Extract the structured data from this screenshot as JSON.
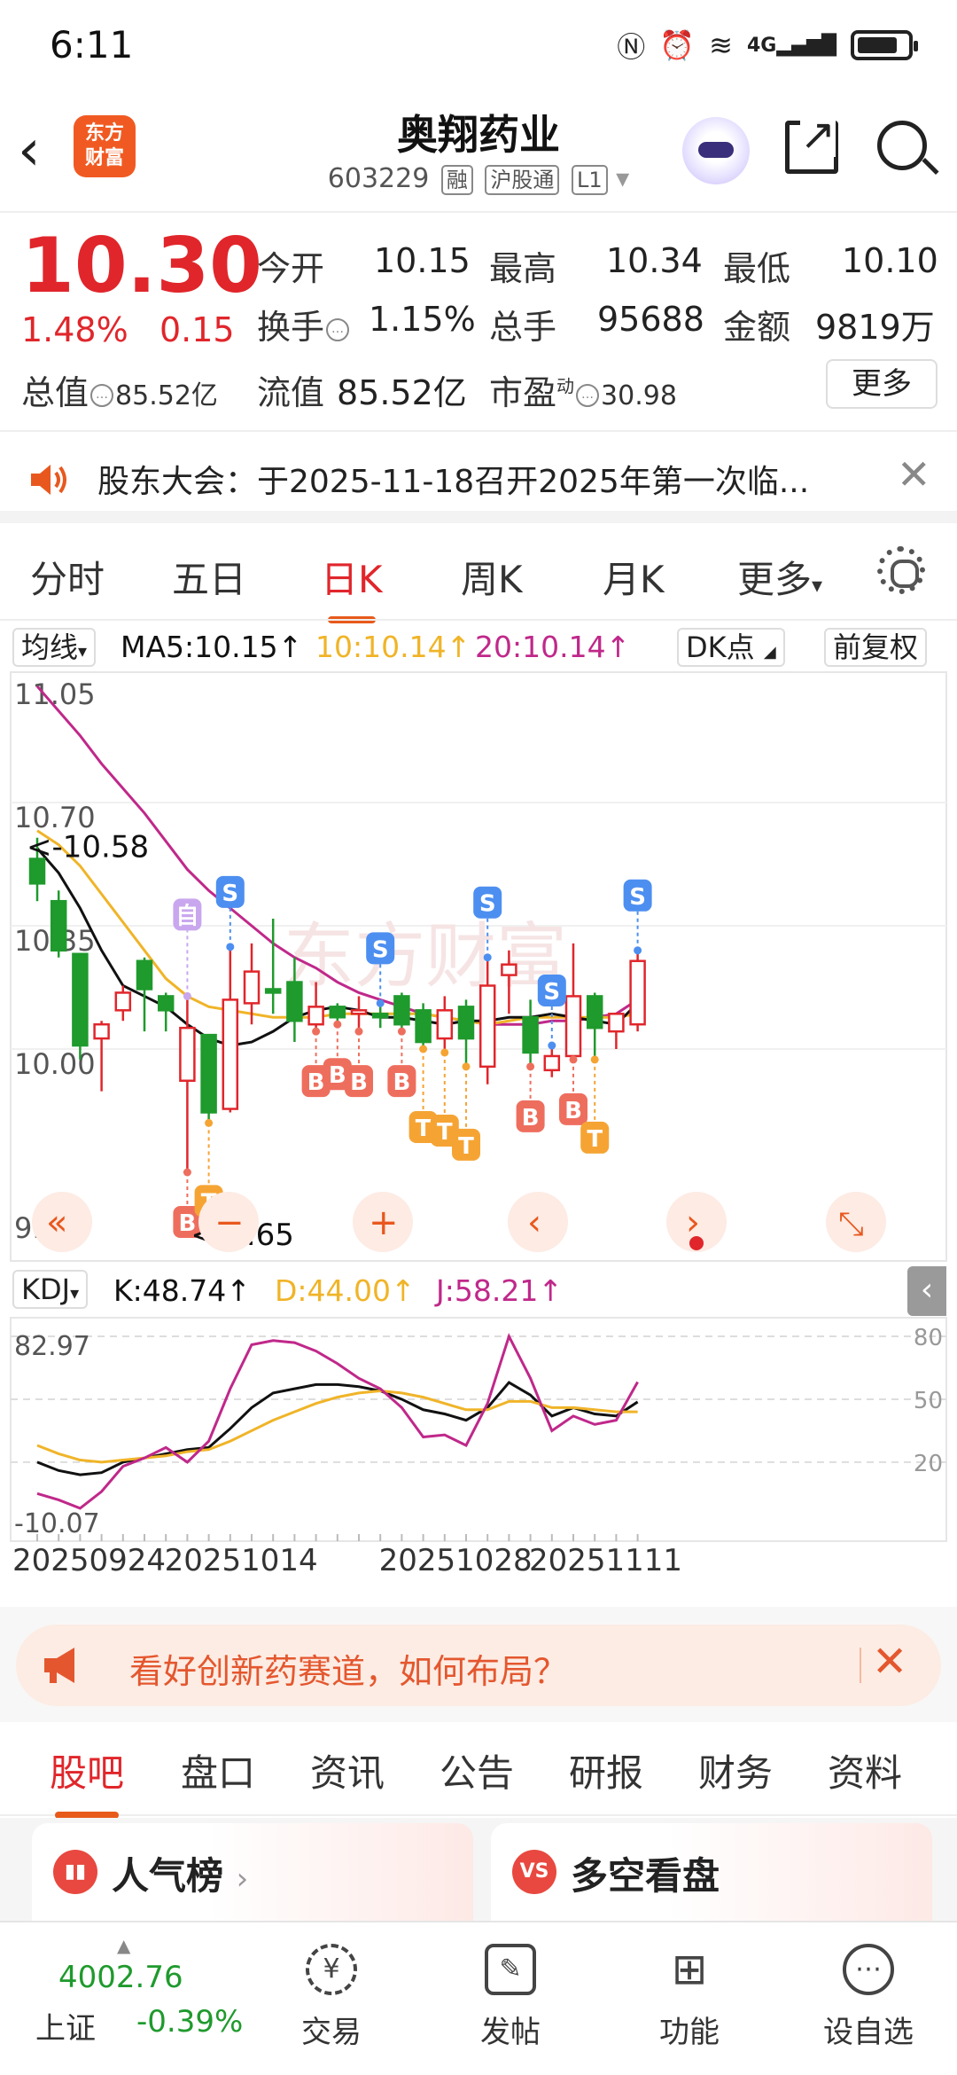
{
  "status_bar": {
    "time": "6:11",
    "icons": [
      "nfc-icon",
      "alarm-icon",
      "wifi-icon",
      "4g-signal-icon",
      "battery-icon"
    ],
    "network": "4G"
  },
  "header": {
    "logo_text_1": "东方",
    "logo_text_2": "财富",
    "stock_name": "奥翔药业",
    "stock_code": "603229",
    "tags": [
      "融",
      "沪股通",
      "L1"
    ]
  },
  "quote": {
    "price": "10.30",
    "change_pct": "1.48%",
    "change_abs": "0.15",
    "open_label": "今开",
    "open": "10.15",
    "high_label": "最高",
    "high": "10.34",
    "low_label": "最低",
    "low": "10.10",
    "turnover_label": "换手",
    "turnover": "1.15%",
    "volume_label": "总手",
    "volume": "95688",
    "amount_label": "金额",
    "amount": "9819万",
    "total_cap_label": "总值",
    "total_cap": "85.52亿",
    "float_cap_label": "流值",
    "float_cap": "85.52亿",
    "pe_label": "市盈",
    "pe_sup": "动",
    "pe": "30.98",
    "more_label": "更多"
  },
  "notice": {
    "text": "股东大会：于2025-11-18召开2025年第一次临..."
  },
  "chart_tabs": [
    "分时",
    "五日",
    "日K",
    "周K",
    "月K",
    "更多"
  ],
  "active_chart_tab": "日K",
  "ma_row": {
    "selector": "均线",
    "ma5": "MA5:10.15↑",
    "ma10": "10:10.14↑",
    "ma20": "20:10.14↑",
    "dk_label": "DK点",
    "adjust_label": "前复权"
  },
  "colors": {
    "up": "#e0262b",
    "down": "#1f9a2d",
    "ma5": "#111111",
    "ma10": "#f0b428",
    "ma20": "#c0288a",
    "accent": "#e85a1a"
  },
  "chart_data": [
    {
      "type": "candlestick",
      "ylim": [
        9.65,
        11.05
      ],
      "y_ticks": [
        "11.05",
        "10.70",
        "10.35",
        "10.00",
        "9.65"
      ],
      "annotations": {
        "max_label": "<-10.58",
        "min_label": "<-9.65"
      },
      "candles": [
        {
          "o": 10.54,
          "c": 10.47,
          "h": 10.6,
          "l": 10.42
        },
        {
          "o": 10.42,
          "c": 10.28,
          "h": 10.45,
          "l": 10.26
        },
        {
          "o": 10.27,
          "c": 10.01,
          "h": 10.27,
          "l": 9.97
        },
        {
          "o": 10.03,
          "c": 10.07,
          "h": 10.08,
          "l": 9.88
        },
        {
          "o": 10.11,
          "c": 10.16,
          "h": 10.18,
          "l": 10.08
        },
        {
          "o": 10.25,
          "c": 10.17,
          "h": 10.26,
          "l": 10.05
        },
        {
          "o": 10.15,
          "c": 10.11,
          "h": 10.16,
          "l": 10.05
        },
        {
          "o": 9.91,
          "c": 10.06,
          "h": 10.15,
          "l": 9.65
        },
        {
          "o": 10.04,
          "c": 9.82,
          "h": 10.04,
          "l": 9.79
        },
        {
          "o": 9.83,
          "c": 10.14,
          "h": 10.29,
          "l": 9.82
        },
        {
          "o": 10.13,
          "c": 10.22,
          "h": 10.3,
          "l": 10.07
        },
        {
          "o": 10.17,
          "c": 10.16,
          "h": 10.37,
          "l": 10.1
        },
        {
          "o": 10.19,
          "c": 10.08,
          "h": 10.26,
          "l": 10.02
        },
        {
          "o": 10.07,
          "c": 10.12,
          "h": 10.19,
          "l": 10.05
        },
        {
          "o": 10.12,
          "c": 10.09,
          "h": 10.13,
          "l": 10.07
        },
        {
          "o": 10.1,
          "c": 10.11,
          "h": 10.15,
          "l": 10.05
        },
        {
          "o": 10.1,
          "c": 10.09,
          "h": 10.13,
          "l": 10.06
        },
        {
          "o": 10.15,
          "c": 10.07,
          "h": 10.16,
          "l": 10.05
        },
        {
          "o": 10.11,
          "c": 10.02,
          "h": 10.13,
          "l": 10.0
        },
        {
          "o": 10.03,
          "c": 10.11,
          "h": 10.15,
          "l": 9.99
        },
        {
          "o": 10.12,
          "c": 10.03,
          "h": 10.14,
          "l": 9.95
        },
        {
          "o": 9.95,
          "c": 10.18,
          "h": 10.26,
          "l": 9.9
        },
        {
          "o": 10.21,
          "c": 10.24,
          "h": 10.28,
          "l": 10.1
        },
        {
          "o": 10.09,
          "c": 9.99,
          "h": 10.14,
          "l": 9.95
        },
        {
          "o": 9.94,
          "c": 9.98,
          "h": 10.01,
          "l": 9.92
        },
        {
          "o": 9.98,
          "c": 10.15,
          "h": 10.3,
          "l": 9.97
        },
        {
          "o": 10.15,
          "c": 10.06,
          "h": 10.16,
          "l": 9.97
        },
        {
          "o": 10.05,
          "c": 10.1,
          "h": 10.09,
          "l": 10.0
        },
        {
          "o": 10.07,
          "c": 10.25,
          "h": 10.28,
          "l": 10.05
        }
      ],
      "ma5": [
        10.57,
        10.5,
        10.4,
        10.28,
        10.18,
        10.15,
        10.12,
        10.07,
        10.03,
        10.01,
        10.02,
        10.05,
        10.09,
        10.11,
        10.12,
        10.11,
        10.09,
        10.09,
        10.08,
        10.07,
        10.08,
        10.08,
        10.09,
        10.09,
        10.1,
        10.09,
        10.08,
        10.07,
        10.13
      ],
      "ma10": [
        10.62,
        10.58,
        10.52,
        10.44,
        10.36,
        10.28,
        10.2,
        10.15,
        10.12,
        10.11,
        10.1,
        10.09,
        10.09,
        10.09,
        10.1,
        10.1,
        10.1,
        10.1,
        10.1,
        10.09,
        10.08,
        10.07,
        10.08,
        10.09,
        10.09,
        10.09,
        10.09,
        10.09,
        10.1
      ],
      "ma20": [
        11.03,
        10.96,
        10.89,
        10.81,
        10.74,
        10.67,
        10.59,
        10.51,
        10.45,
        10.4,
        10.35,
        10.3,
        10.26,
        10.23,
        10.19,
        10.16,
        10.14,
        10.12,
        10.1,
        10.09,
        10.08,
        10.07,
        10.07,
        10.07,
        10.08,
        10.08,
        10.09,
        10.1,
        10.14
      ],
      "signals": [
        {
          "i": 7,
          "label": "自",
          "kind": "zi"
        },
        {
          "i": 7,
          "label": "B",
          "kind": "buy"
        },
        {
          "i": 8,
          "label": "T",
          "kind": "t"
        },
        {
          "i": 9,
          "label": "S",
          "kind": "sell"
        },
        {
          "i": 13,
          "label": "B",
          "kind": "buy"
        },
        {
          "i": 14,
          "label": "B",
          "kind": "buy"
        },
        {
          "i": 15,
          "label": "B",
          "kind": "buy"
        },
        {
          "i": 16,
          "label": "S",
          "kind": "sell"
        },
        {
          "i": 17,
          "label": "B",
          "kind": "buy"
        },
        {
          "i": 18,
          "label": "T",
          "kind": "t"
        },
        {
          "i": 19,
          "label": "T",
          "kind": "t"
        },
        {
          "i": 20,
          "label": "T",
          "kind": "t"
        },
        {
          "i": 21,
          "label": "S",
          "kind": "sell"
        },
        {
          "i": 23,
          "label": "B",
          "kind": "buy"
        },
        {
          "i": 24,
          "label": "S",
          "kind": "sell"
        },
        {
          "i": 25,
          "label": "B",
          "kind": "buy"
        },
        {
          "i": 26,
          "label": "T",
          "kind": "t"
        },
        {
          "i": 28,
          "label": "S",
          "kind": "sell"
        }
      ]
    },
    {
      "type": "line",
      "name": "KDJ",
      "ylim": [
        -10.07,
        82.97
      ],
      "y_ticks_left": [
        "82.97",
        "-10.07"
      ],
      "y_ticks_right": [
        "80",
        "50",
        "20"
      ],
      "x_labels": [
        "20250924",
        "20251014",
        "20251028",
        "20251111"
      ],
      "x_label_index": [
        0,
        8,
        18,
        25
      ],
      "series": [
        {
          "name": "K",
          "label": "K:48.74↑",
          "values": [
            20,
            16,
            14,
            15,
            20,
            22,
            24,
            26,
            27,
            36,
            46,
            53,
            55,
            57,
            57,
            56,
            54,
            50,
            45,
            43,
            40,
            46,
            58,
            52,
            42,
            46,
            43,
            42,
            48.74
          ]
        },
        {
          "name": "D",
          "label": "D:44.00↑",
          "values": [
            28,
            24,
            21,
            20,
            21,
            22,
            23,
            25,
            26,
            30,
            35,
            40,
            44,
            48,
            51,
            53,
            54,
            53,
            51,
            48,
            45,
            45,
            49,
            49,
            46,
            46,
            45,
            44,
            44.0
          ]
        },
        {
          "name": "J",
          "label": "J:58.21↑",
          "values": [
            5,
            2,
            -2,
            6,
            18,
            22,
            27,
            20,
            30,
            55,
            76,
            78,
            77,
            73,
            67,
            60,
            55,
            46,
            32,
            33,
            28,
            48,
            80,
            60,
            35,
            42,
            38,
            40,
            58.21
          ]
        }
      ]
    }
  ],
  "promo": {
    "text": "看好创新药赛道，如何布局？"
  },
  "info_tabs": [
    "股吧",
    "盘口",
    "资讯",
    "公告",
    "研报",
    "财务",
    "资料"
  ],
  "active_info_tab": "股吧",
  "cards": [
    {
      "title": "人气榜",
      "icon": "chart-icon"
    },
    {
      "title": "多空看盘",
      "icon": "vs-icon"
    }
  ],
  "bottom_nav": {
    "index_value": "4002.76",
    "index_name": "上证",
    "index_change": "-0.39%",
    "items": [
      "交易",
      "发帖",
      "功能",
      "设自选"
    ]
  }
}
